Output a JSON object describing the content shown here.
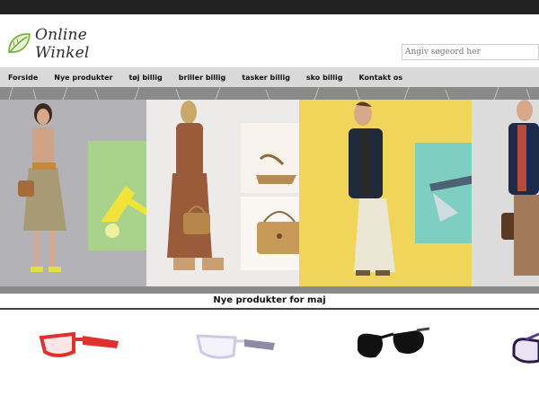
{
  "site": {
    "logo_text": "Online Winkel"
  },
  "search": {
    "placeholder": "Angiv søgeord her"
  },
  "nav": {
    "items": [
      {
        "label": "Forside"
      },
      {
        "label": "Nye produkter"
      },
      {
        "label": "tøj billig"
      },
      {
        "label": "briller billig"
      },
      {
        "label": "tasker billig"
      },
      {
        "label": "sko billig"
      },
      {
        "label": "Kontakt os"
      }
    ]
  },
  "section": {
    "title": "Nye produkter for maj"
  },
  "products": [
    {
      "icon": "red-glasses-icon",
      "color": "#e03030"
    },
    {
      "icon": "white-glasses-icon",
      "color": "#e8e6f2"
    },
    {
      "icon": "black-sunglasses-icon",
      "color": "#111111"
    },
    {
      "icon": "purple-glasses-icon",
      "color": "#5a3a8a"
    }
  ],
  "colors": {
    "top_strip": "#222222",
    "nav_bg": "#d9d9d9",
    "logo_leaf": "#6fae2f"
  }
}
